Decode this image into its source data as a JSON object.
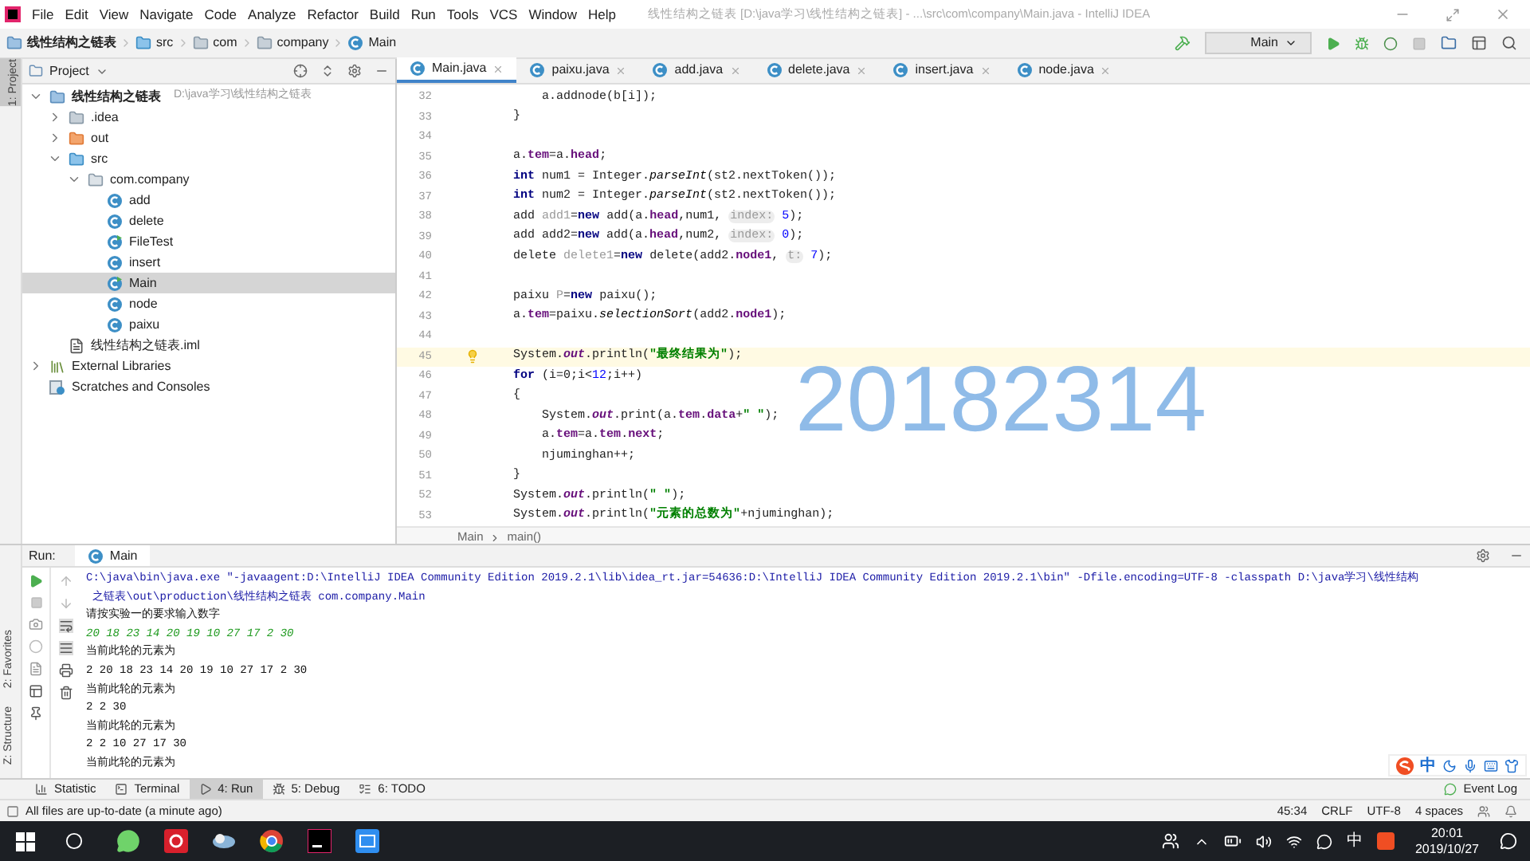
{
  "window": {
    "title": "线性结构之链表 [D:\\java学习\\线性结构之链表] - ...\\src\\com\\company\\Main.java - IntelliJ IDEA"
  },
  "menu": [
    "File",
    "Edit",
    "View",
    "Navigate",
    "Code",
    "Analyze",
    "Refactor",
    "Build",
    "Run",
    "Tools",
    "VCS",
    "Window",
    "Help"
  ],
  "breadcrumbs": [
    {
      "label": "线性结构之链表",
      "kind": "module"
    },
    {
      "label": "src",
      "kind": "source"
    },
    {
      "label": "com",
      "kind": "folder"
    },
    {
      "label": "company",
      "kind": "folder"
    },
    {
      "label": "Main",
      "kind": "class"
    }
  ],
  "run_config": "Main",
  "left_strip": [
    "1: Project"
  ],
  "project": {
    "title": "Project",
    "tree": [
      {
        "label": "线性结构之链表",
        "path": "D:\\java学习\\线性结构之链表",
        "kind": "module",
        "expanded": true,
        "selected": false,
        "children": [
          {
            "label": ".idea",
            "kind": "folder",
            "expanded": false,
            "selected": false
          },
          {
            "label": "out",
            "kind": "excluded",
            "expanded": false,
            "selected": false
          },
          {
            "label": "src",
            "kind": "source",
            "expanded": true,
            "selected": false,
            "children": [
              {
                "label": "com.company",
                "kind": "package",
                "expanded": true,
                "selected": false,
                "children": [
                  {
                    "label": "add",
                    "kind": "class",
                    "selected": false
                  },
                  {
                    "label": "delete",
                    "kind": "class",
                    "selected": false
                  },
                  {
                    "label": "FileTest",
                    "kind": "main",
                    "selected": false
                  },
                  {
                    "label": "insert",
                    "kind": "class",
                    "selected": false
                  },
                  {
                    "label": "Main",
                    "kind": "main",
                    "selected": true
                  },
                  {
                    "label": "node",
                    "kind": "class",
                    "selected": false
                  },
                  {
                    "label": "paixu",
                    "kind": "class",
                    "selected": false
                  }
                ]
              }
            ]
          },
          {
            "label": "线性结构之链表.iml",
            "kind": "iml",
            "selected": false
          }
        ]
      },
      {
        "label": "External Libraries",
        "kind": "libraries",
        "expanded": false,
        "selected": false
      },
      {
        "label": "Scratches and Consoles",
        "kind": "scratches",
        "selected": false
      }
    ]
  },
  "editor_tabs": [
    {
      "label": "Main.java",
      "selected": true
    },
    {
      "label": "paixu.java",
      "selected": false
    },
    {
      "label": "add.java",
      "selected": false
    },
    {
      "label": "delete.java",
      "selected": false
    },
    {
      "label": "insert.java",
      "selected": false
    },
    {
      "label": "node.java",
      "selected": false
    }
  ],
  "code": [
    {
      "number": "32",
      "tokens": [
        {
          "kind": "plain",
          "text": "    a.addnode(b[i]);"
        }
      ]
    },
    {
      "number": "33",
      "tokens": [
        {
          "kind": "plain",
          "text": "}"
        }
      ]
    },
    {
      "number": "34"
    },
    {
      "number": "35",
      "tokens": [
        {
          "kind": "plain",
          "text": "a."
        },
        {
          "kind": "f",
          "text": "tem"
        },
        {
          "kind": "plain",
          "text": "=a."
        },
        {
          "kind": "f",
          "text": "head"
        },
        {
          "kind": "plain",
          "text": ";"
        }
      ]
    },
    {
      "number": "36",
      "tokens": [
        {
          "kind": "kw",
          "text": "int"
        },
        {
          "kind": "plain",
          "text": " num1 = Integer."
        },
        {
          "kind": "i",
          "text": "parseInt"
        },
        {
          "kind": "plain",
          "text": "(st2.nextToken());"
        }
      ]
    },
    {
      "number": "37",
      "tokens": [
        {
          "kind": "kw",
          "text": "int"
        },
        {
          "kind": "plain",
          "text": " num2 = Integer."
        },
        {
          "kind": "i",
          "text": "parseInt"
        },
        {
          "kind": "plain",
          "text": "(st2.nextToken());"
        }
      ]
    },
    {
      "number": "38",
      "tokens": [
        {
          "kind": "plain",
          "text": "add "
        },
        {
          "kind": "u",
          "text": "add1"
        },
        {
          "kind": "plain",
          "text": "="
        },
        {
          "kind": "kw",
          "text": "new"
        },
        {
          "kind": "plain",
          "text": " add(a."
        },
        {
          "kind": "f",
          "text": "head"
        },
        {
          "kind": "plain",
          "text": ",num1, "
        },
        {
          "kind": "h",
          "text": "index:"
        },
        {
          "kind": "n",
          "text": " 5"
        },
        {
          "kind": "plain",
          "text": ");"
        }
      ]
    },
    {
      "number": "39",
      "tokens": [
        {
          "kind": "plain",
          "text": "add add2="
        },
        {
          "kind": "kw",
          "text": "new"
        },
        {
          "kind": "plain",
          "text": " add(a."
        },
        {
          "kind": "f",
          "text": "head"
        },
        {
          "kind": "plain",
          "text": ",num2, "
        },
        {
          "kind": "h",
          "text": "index:"
        },
        {
          "kind": "n",
          "text": " 0"
        },
        {
          "kind": "plain",
          "text": ");"
        }
      ]
    },
    {
      "number": "40",
      "tokens": [
        {
          "kind": "plain",
          "text": "delete "
        },
        {
          "kind": "u",
          "text": "delete1"
        },
        {
          "kind": "plain",
          "text": "="
        },
        {
          "kind": "kw",
          "text": "new"
        },
        {
          "kind": "plain",
          "text": " delete(add2."
        },
        {
          "kind": "f",
          "text": "node1"
        },
        {
          "kind": "plain",
          "text": ", "
        },
        {
          "kind": "h",
          "text": "t:"
        },
        {
          "kind": "n",
          "text": " 7"
        },
        {
          "kind": "plain",
          "text": ");"
        }
      ]
    },
    {
      "number": "41"
    },
    {
      "number": "42",
      "tokens": [
        {
          "kind": "plain",
          "text": "paixu "
        },
        {
          "kind": "u",
          "text": "P"
        },
        {
          "kind": "plain",
          "text": "="
        },
        {
          "kind": "kw",
          "text": "new"
        },
        {
          "kind": "plain",
          "text": " paixu();"
        }
      ]
    },
    {
      "number": "43",
      "tokens": [
        {
          "kind": "plain",
          "text": "a."
        },
        {
          "kind": "f",
          "text": "tem"
        },
        {
          "kind": "plain",
          "text": "=paixu."
        },
        {
          "kind": "i",
          "text": "selectionSort"
        },
        {
          "kind": "plain",
          "text": "(add2."
        },
        {
          "kind": "f",
          "text": "node1"
        },
        {
          "kind": "plain",
          "text": ");"
        }
      ]
    },
    {
      "number": "44"
    },
    {
      "number": "45",
      "current": true,
      "tokens": [
        {
          "kind": "plain",
          "text": "System."
        },
        {
          "kind": "fi",
          "text": "out"
        },
        {
          "kind": "plain",
          "text": ".println("
        },
        {
          "kind": "s",
          "text": "\"最终结果为\""
        },
        {
          "kind": "plain",
          "text": ");"
        }
      ]
    },
    {
      "number": "46",
      "tokens": [
        {
          "kind": "kw",
          "text": "for"
        },
        {
          "kind": "plain",
          "text": " (i=0;i<"
        },
        {
          "kind": "n",
          "text": "12"
        },
        {
          "kind": "plain",
          "text": ";i++)"
        }
      ]
    },
    {
      "number": "47",
      "tokens": [
        {
          "kind": "plain",
          "text": "{"
        }
      ]
    },
    {
      "number": "48",
      "tokens": [
        {
          "kind": "plain",
          "text": "    System."
        },
        {
          "kind": "fi",
          "text": "out"
        },
        {
          "kind": "plain",
          "text": ".print(a."
        },
        {
          "kind": "f",
          "text": "tem"
        },
        {
          "kind": "plain",
          "text": "."
        },
        {
          "kind": "f",
          "text": "data"
        },
        {
          "kind": "plain",
          "text": "+"
        },
        {
          "kind": "s",
          "text": "\" \""
        },
        {
          "kind": "plain",
          "text": ");"
        }
      ]
    },
    {
      "number": "49",
      "tokens": [
        {
          "kind": "plain",
          "text": "    a."
        },
        {
          "kind": "f",
          "text": "tem"
        },
        {
          "kind": "plain",
          "text": "=a."
        },
        {
          "kind": "f",
          "text": "tem"
        },
        {
          "kind": "plain",
          "text": "."
        },
        {
          "kind": "f",
          "text": "next"
        },
        {
          "kind": "plain",
          "text": ";"
        }
      ]
    },
    {
      "number": "50",
      "tokens": [
        {
          "kind": "plain",
          "text": "    njuminghan++;"
        }
      ]
    },
    {
      "number": "51",
      "tokens": [
        {
          "kind": "plain",
          "text": "}"
        }
      ]
    },
    {
      "number": "52",
      "tokens": [
        {
          "kind": "plain",
          "text": "System."
        },
        {
          "kind": "fi",
          "text": "out"
        },
        {
          "kind": "plain",
          "text": ".println("
        },
        {
          "kind": "s",
          "text": "\" \""
        },
        {
          "kind": "plain",
          "text": ");"
        }
      ]
    },
    {
      "number": "53",
      "tokens": [
        {
          "kind": "plain",
          "text": "System."
        },
        {
          "kind": "fi",
          "text": "out"
        },
        {
          "kind": "plain",
          "text": ".println("
        },
        {
          "kind": "s",
          "text": "\"元素的总数为\""
        },
        {
          "kind": "plain",
          "text": "+njuminghan);"
        }
      ]
    }
  ],
  "overlay_number": "20182314",
  "editor_breadcrumbs": [
    "Main",
    "main()"
  ],
  "run_panel": {
    "label": "Run:",
    "tab": "Main",
    "side_labels": [
      "2: Favorites",
      "Z: Structure"
    ],
    "console": [
      {
        "kind": "command",
        "text": "C:\\java\\bin\\java.exe \"-javaagent:D:\\IntelliJ IDEA Community Edition 2019.2.1\\lib\\idea_rt.jar=54636:D:\\IntelliJ IDEA Community Edition 2019.2.1\\bin\" -Dfile.encoding=UTF-8 -classpath D:\\java学习\\线性结构"
      },
      {
        "kind": "command",
        "text": " 之链表\\out\\production\\线性结构之链表 com.company.Main"
      },
      {
        "kind": "output",
        "text": "请按实验一的要求输入数字"
      },
      {
        "kind": "input",
        "text": "20 18 23 14 20 19 10 27 17 2 30"
      },
      {
        "kind": "output",
        "text": "当前此轮的元素为"
      },
      {
        "kind": "output",
        "text": "2 20 18 23 14 20 19 10 27 17 2 30"
      },
      {
        "kind": "output",
        "text": "当前此轮的元素为"
      },
      {
        "kind": "output",
        "text": "2 2 30"
      },
      {
        "kind": "output",
        "text": "当前此轮的元素为"
      },
      {
        "kind": "output",
        "text": "2 2 10 27 17 30"
      },
      {
        "kind": "output",
        "text": "当前此轮的元素为"
      }
    ]
  },
  "ime_bar": {
    "mode": "中"
  },
  "tool_tabs": [
    {
      "label": "Statistic",
      "kind": "statistic",
      "selected": false
    },
    {
      "label": "Terminal",
      "kind": "terminal",
      "selected": false
    },
    {
      "label": "4: Run",
      "kind": "run",
      "selected": true
    },
    {
      "label": "5: Debug",
      "kind": "debug",
      "selected": false
    },
    {
      "label": "6: TODO",
      "kind": "todo",
      "selected": false
    }
  ],
  "event_log": "Event Log",
  "status_bar": {
    "message": "All files are up-to-date (a minute ago)",
    "position": "45:34",
    "line_separator": "CRLF",
    "encoding": "UTF-8",
    "indent": "4 spaces"
  },
  "taskbar": {
    "input_mode": "中",
    "time": "20:01",
    "date": "2019/10/27"
  }
}
